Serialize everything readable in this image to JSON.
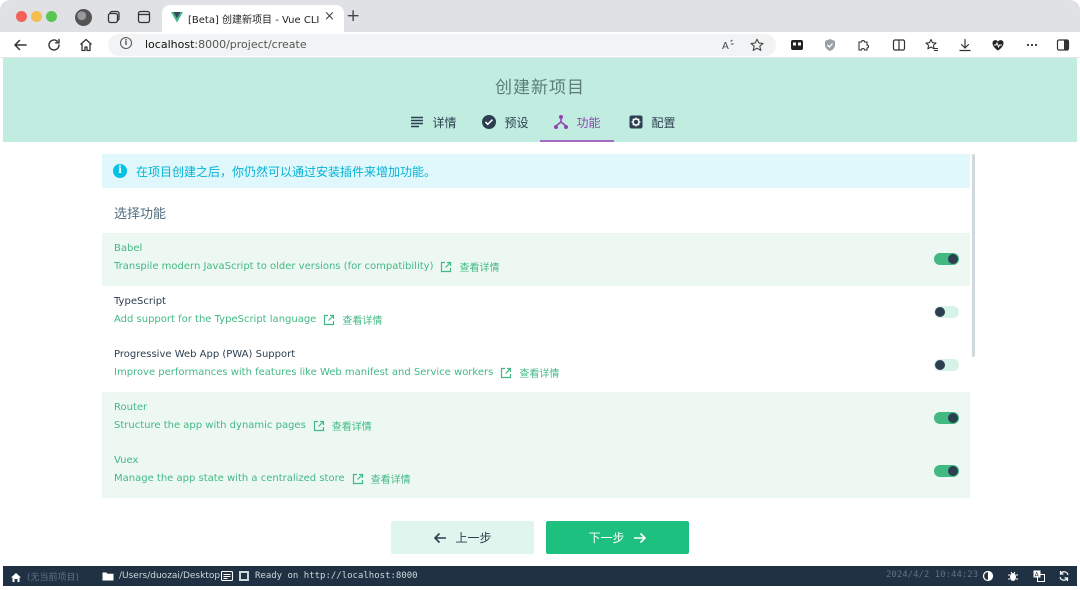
{
  "browser": {
    "tab_title": "[Beta] 创建新项目 - Vue CLI",
    "tab_close": "×",
    "new_tab": "+",
    "url_host": "localhost",
    "url_rest": ":8000/project/create",
    "info_glyph": "i"
  },
  "page": {
    "title": "创建新项目",
    "steps": [
      {
        "label": "详情",
        "icon": "list-icon"
      },
      {
        "label": "预设",
        "icon": "check-circle-icon"
      },
      {
        "label": "功能",
        "icon": "fork-icon",
        "active": true
      },
      {
        "label": "配置",
        "icon": "gear-icon"
      }
    ],
    "info": {
      "text": "在项目创建之后，你仍然可以通过安装插件来增加功能。",
      "glyph": "i"
    },
    "section_title": "选择功能",
    "more_info": "查看详情",
    "features": [
      {
        "name": "Babel",
        "desc": "Transpile modern JavaScript to older versions (for compatibility)",
        "enabled": true
      },
      {
        "name": "TypeScript",
        "desc": "Add support for the TypeScript language",
        "enabled": false
      },
      {
        "name": "Progressive Web App (PWA) Support",
        "desc": "Improve performances with features like Web manifest and Service workers",
        "enabled": false
      },
      {
        "name": "Router",
        "desc": "Structure the app with dynamic pages",
        "enabled": true
      },
      {
        "name": "Vuex",
        "desc": "Manage the app state with a centralized store",
        "enabled": true
      }
    ],
    "prev_label": "上一步",
    "next_label": "下一步"
  },
  "statusbar": {
    "current_project": "(无当前项目)",
    "folder": "/Users/duozai/Desktop",
    "log": "Ready on http://localhost:8000",
    "datetime": "2024/4/2 10:44:23"
  },
  "colors": {
    "accent": "#42b983",
    "header_bg": "#c0ede0",
    "active_step": "#8e44ad",
    "statusbar_bg": "#1f3143",
    "info_bg": "#e0f8fc"
  }
}
